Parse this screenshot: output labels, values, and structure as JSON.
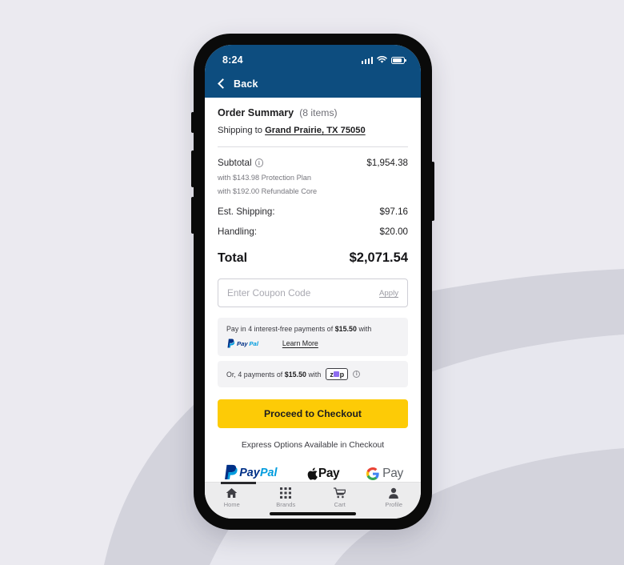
{
  "status_bar": {
    "time": "8:24",
    "signal_icon": "cellular-signal-icon",
    "wifi_icon": "wifi-icon",
    "battery_icon": "battery-icon"
  },
  "nav": {
    "back_icon": "chevron-left-icon",
    "back_label": "Back"
  },
  "summary": {
    "title": "Order Summary",
    "item_count": "(8 items)",
    "shipping_prefix": "Shipping to",
    "shipping_address": "Grand Prairie, TX 75050"
  },
  "totals": {
    "subtotal_label": "Subtotal",
    "subtotal_info_icon": "info-circle-icon",
    "subtotal_value": "$1,954.38",
    "note_protection": "with $143.98 Protection Plan",
    "note_refundable": "with $192.00 Refundable Core",
    "shipping_label": "Est. Shipping:",
    "shipping_value": "$97.16",
    "handling_label": "Handling:",
    "handling_value": "$20.00",
    "total_label": "Total",
    "total_value": "$2,071.54"
  },
  "coupon": {
    "placeholder": "Enter Coupon Code",
    "value": "",
    "apply_label": "Apply"
  },
  "financing": {
    "paypal": {
      "text_before": "Pay in 4 interest-free payments of",
      "amount": "$15.50",
      "text_after": "with",
      "logo_icon": "paypal-logo-icon",
      "learn_more_label": "Learn More"
    },
    "zip": {
      "text_before": "Or, 4 payments of",
      "amount": "$15.50",
      "text_after": "with",
      "logo_label": "zip",
      "logo_icon": "zip-logo-icon",
      "info_icon": "info-circle-icon",
      "accent_color": "#8e6df0"
    }
  },
  "checkout": {
    "button_label": "Proceed to Checkout",
    "button_color": "#fdcb06",
    "express_note": "Express Options Available in Checkout",
    "logos": [
      {
        "name": "paypal-logo",
        "label": "PayPal"
      },
      {
        "name": "apple-pay-logo",
        "label": "Pay"
      },
      {
        "name": "google-pay-logo",
        "label": "Pay"
      }
    ]
  },
  "tabbar": {
    "items": [
      {
        "label": "Home",
        "icon": "home-icon",
        "active": true
      },
      {
        "label": "Brands",
        "icon": "grid-icon",
        "active": false
      },
      {
        "label": "Cart",
        "icon": "cart-icon",
        "active": false
      },
      {
        "label": "Profile",
        "icon": "person-icon",
        "active": false
      }
    ]
  },
  "theme": {
    "header_blue": "#0d4d7f",
    "page_background": "#ebeaf0"
  }
}
